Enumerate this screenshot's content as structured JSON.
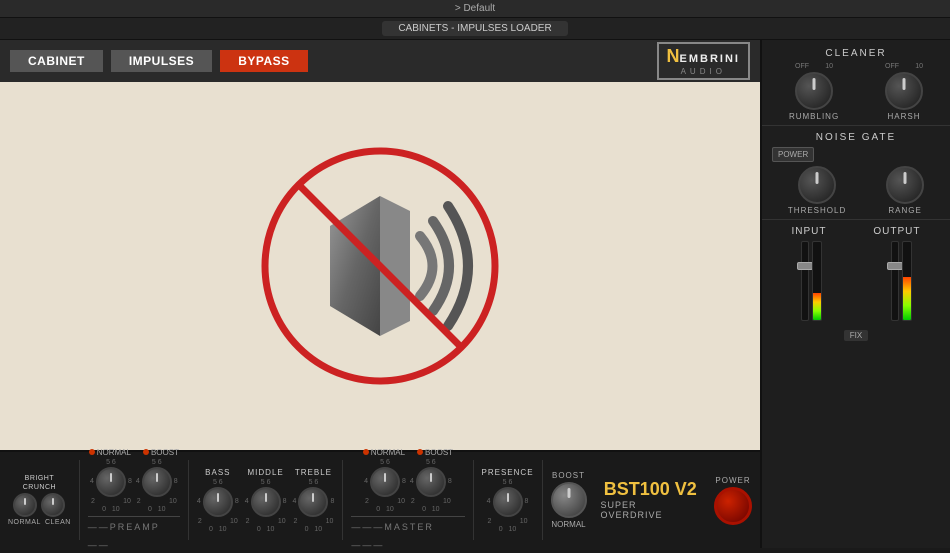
{
  "titleBar": {
    "text": "> Default"
  },
  "subTitleBar": {
    "text": "CABINETS - IMPULSES LOADER"
  },
  "tabs": {
    "cabinet": "CABINET",
    "impulses": "IMPULSES",
    "bypass": "BYPASS"
  },
  "logo": {
    "n": "N",
    "embrini": "EMBRINI",
    "audio": "AUDIO"
  },
  "cleaner": {
    "title": "CLEANER",
    "knob1Label": "RUMBLING",
    "knob2Label": "HARSH",
    "knob1Range": {
      "min": "OFF",
      "max": "10"
    },
    "knob2Range": {
      "min": "OFF",
      "max": "10"
    }
  },
  "noiseGate": {
    "title": "NOISE GATE",
    "powerLabel": "POWER",
    "knob1Label": "THRESHOLD",
    "knob2Label": "RANGE"
  },
  "io": {
    "inputLabel": "INPUT",
    "outputLabel": "OUTPUT",
    "fixLabel": "FIX"
  },
  "bottomBar": {
    "brightLabel": "BRIGHT",
    "normalLabel": "NORMAL",
    "cleanLabel": "CLEAN",
    "normalLed": "●NORMAL",
    "boostLed": "●BOOST",
    "bassLabel": "BASS",
    "middleLabel": "MIDDLE",
    "trebleLabel": "TREBLE",
    "normalLed2": "●NORMAL",
    "boostLed2": "●BOOST",
    "presenceLabel": "PRESENCE",
    "boostBtnLabel": "BOOST",
    "normalLabel2": "NORMAL",
    "preampLabel": "PREAMP",
    "masterLabel": "MASTER",
    "bstTitle": "BST100 V2",
    "bstSubtitle": "SUPER OVERDRIVE",
    "powerLabel": "POWER"
  }
}
